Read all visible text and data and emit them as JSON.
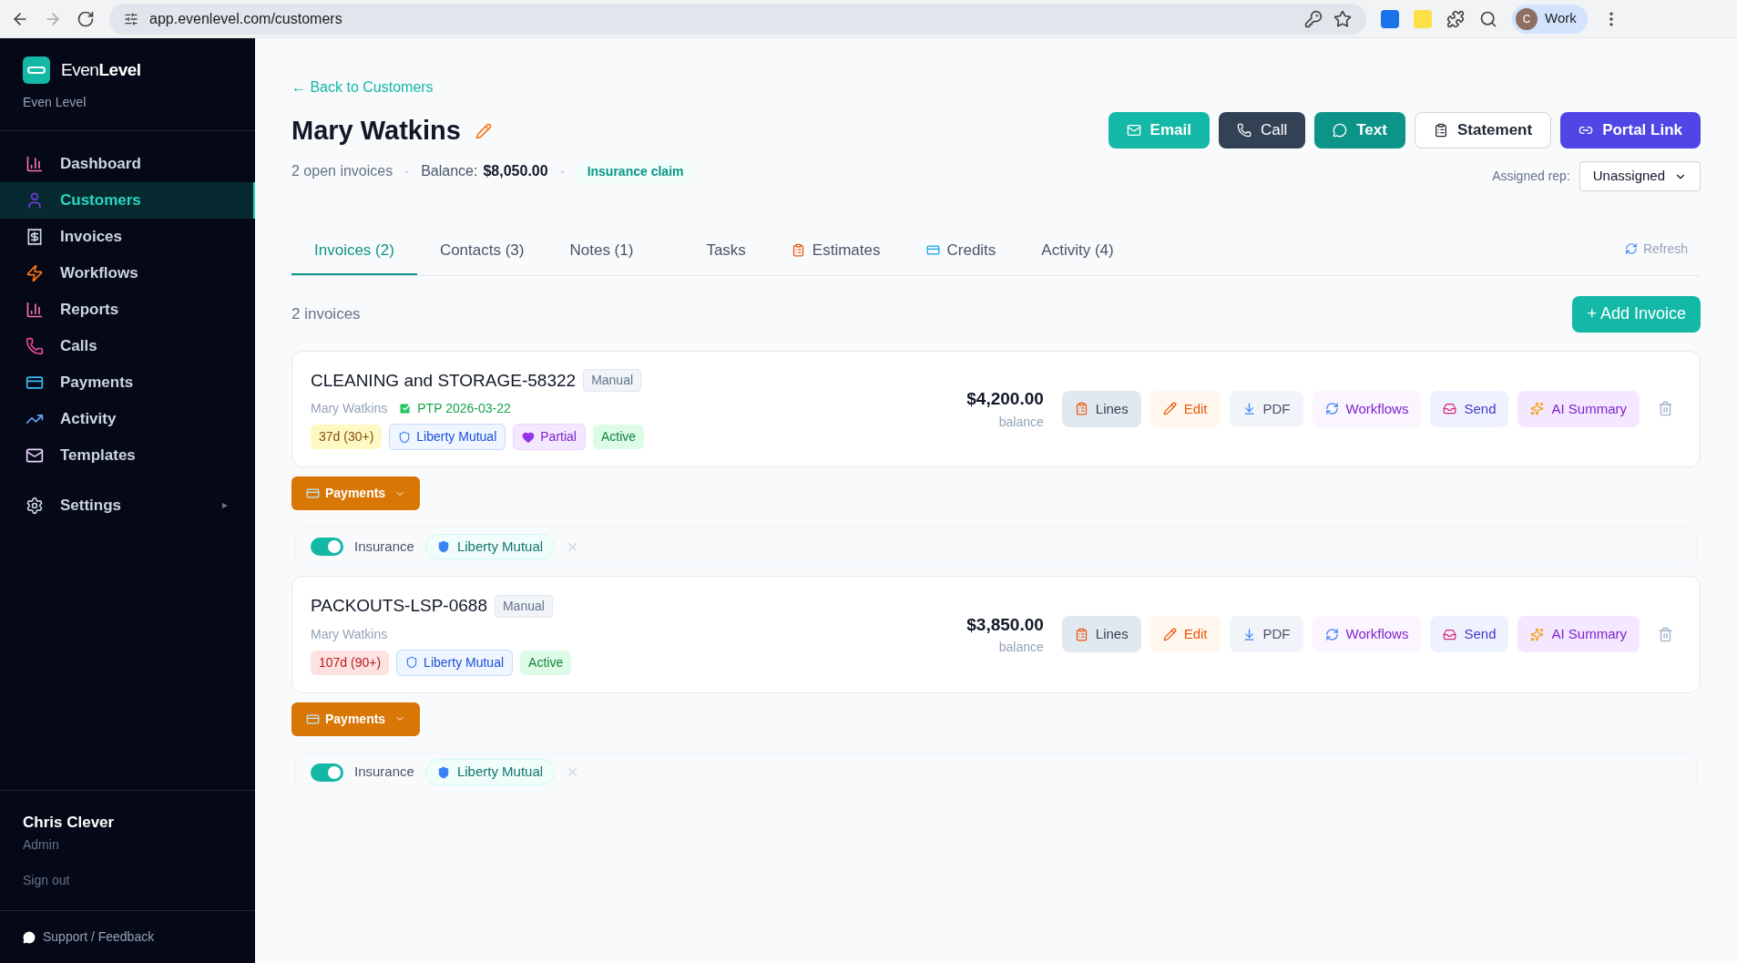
{
  "browser": {
    "url": "app.evenlevel.com/customers",
    "profile_initial": "C",
    "profile_label": "Work"
  },
  "sidebar": {
    "brand": {
      "prefix": "Even",
      "strong": "Level",
      "subtitle": "Even Level"
    },
    "items": [
      {
        "label": "Dashboard",
        "kind": "chart",
        "selected": false
      },
      {
        "label": "Customers",
        "kind": "user",
        "selected": true
      },
      {
        "label": "Invoices",
        "kind": "receipt",
        "selected": false
      },
      {
        "label": "Workflows",
        "kind": "bolt",
        "selected": false
      },
      {
        "label": "Reports",
        "kind": "chart",
        "selected": false
      },
      {
        "label": "Calls",
        "kind": "phone",
        "selected": false
      },
      {
        "label": "Payments",
        "kind": "card",
        "selected": false
      },
      {
        "label": "Activity",
        "kind": "trend",
        "selected": false
      },
      {
        "label": "Templates",
        "kind": "mail",
        "selected": false
      }
    ],
    "settings": {
      "label": "Settings",
      "expanded": false
    },
    "user": {
      "name": "Chris Clever",
      "role": "Admin"
    },
    "sign_out": "Sign out",
    "support": "Support / Feedback"
  },
  "header": {
    "back_link": "← Back to Customers",
    "name": "Mary Watkins",
    "open_invoices": "2 open invoices",
    "balance_label": "Balance:",
    "balance": "$8,050.00",
    "tag": "Insurance claim",
    "buttons": [
      {
        "label": "Email",
        "kind": "email"
      },
      {
        "label": "Call",
        "kind": "call"
      },
      {
        "label": "Text",
        "kind": "text"
      },
      {
        "label": "Statement",
        "kind": "statement"
      },
      {
        "label": "Portal Link",
        "kind": "portal"
      }
    ],
    "assigned_rep": {
      "label": "Assigned rep:",
      "value": "Unassigned"
    }
  },
  "tabs": [
    {
      "label": "Invoices (2)",
      "kind": "plain",
      "selected": true
    },
    {
      "label": "Contacts (3)",
      "kind": "plain",
      "selected": false
    },
    {
      "label": "Notes (1)",
      "kind": "plain",
      "selected": false
    },
    {
      "label": "Tasks",
      "kind": "plain",
      "selected": false
    },
    {
      "label": "Estimates",
      "kind": "clipboard",
      "selected": false
    },
    {
      "label": "Credits",
      "kind": "card",
      "selected": false
    },
    {
      "label": "Activity (4)",
      "kind": "plain",
      "selected": false
    }
  ],
  "refresh": "Refresh",
  "invoice_count": "2 invoices",
  "add_invoice": "+ Add Invoice",
  "invoices": [
    {
      "number": "CLEANING and STORAGE-58322",
      "source": "Manual",
      "customer": "Mary Watkins",
      "ptp": "PTP 2026-03-22",
      "badges": [
        {
          "label": "37d (30+)",
          "kind": "age_warn"
        },
        {
          "label": "Liberty Mutual",
          "kind": "insurer"
        },
        {
          "label": "Partial",
          "kind": "partial"
        },
        {
          "label": "Active",
          "kind": "active"
        }
      ],
      "amount": "$4,200.00",
      "amount_label": "balance",
      "actions": [
        {
          "label": "Lines",
          "kind": "lines"
        },
        {
          "label": "Edit",
          "kind": "edit"
        },
        {
          "label": "PDF",
          "kind": "pdf"
        },
        {
          "label": "Workflows",
          "kind": "workflows"
        },
        {
          "label": "Send",
          "kind": "send"
        },
        {
          "label": "AI Summary",
          "kind": "ai"
        }
      ],
      "payments": "Payments",
      "insurance": {
        "label": "Insurance",
        "on": true,
        "carrier": "Liberty Mutual"
      }
    },
    {
      "number": "PACKOUTS-LSP-0688",
      "source": "Manual",
      "customer": "Mary Watkins",
      "badges": [
        {
          "label": "107d (90+)",
          "kind": "age_danger"
        },
        {
          "label": "Liberty Mutual",
          "kind": "insurer"
        },
        {
          "label": "Active",
          "kind": "active"
        }
      ],
      "amount": "$3,850.00",
      "amount_label": "balance",
      "actions": [
        {
          "label": "Lines",
          "kind": "lines"
        },
        {
          "label": "Edit",
          "kind": "edit"
        },
        {
          "label": "PDF",
          "kind": "pdf"
        },
        {
          "label": "Workflows",
          "kind": "workflows"
        },
        {
          "label": "Send",
          "kind": "send"
        },
        {
          "label": "AI Summary",
          "kind": "ai"
        }
      ],
      "payments": "Payments",
      "insurance": {
        "label": "Insurance",
        "on": true,
        "carrier": "Liberty Mutual"
      }
    }
  ]
}
